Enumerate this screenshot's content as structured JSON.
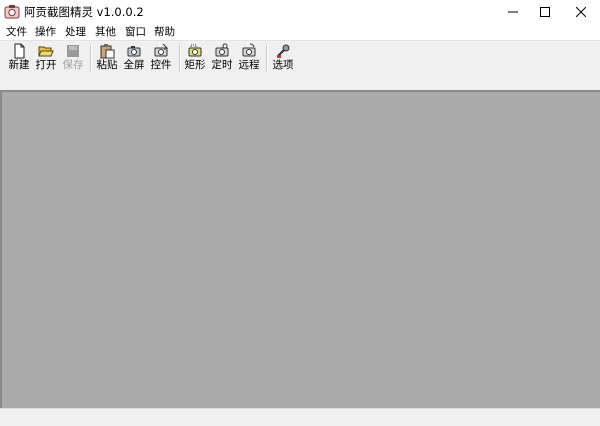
{
  "window": {
    "title": "阿贡截图精灵 v1.0.0.2",
    "icon": "camera-app-icon",
    "controls": [
      "minimize",
      "maximize",
      "close"
    ]
  },
  "menu": [
    "文件",
    "操作",
    "处理",
    "其他",
    "窗口",
    "帮助"
  ],
  "toolbar": {
    "new": {
      "label": "新建",
      "icon": "new-file-icon"
    },
    "open": {
      "label": "打开",
      "icon": "open-folder-icon"
    },
    "save": {
      "label": "保存",
      "icon": "save-icon",
      "disabled": true
    },
    "paste": {
      "label": "粘贴",
      "icon": "paste-icon"
    },
    "fullscreen": {
      "label": "全屏",
      "icon": "fullscreen-capture-icon"
    },
    "control": {
      "label": "控件",
      "icon": "control-capture-icon"
    },
    "rect": {
      "label": "矩形",
      "icon": "rect-capture-icon"
    },
    "timer": {
      "label": "定时",
      "icon": "timer-capture-icon"
    },
    "remote": {
      "label": "远程",
      "icon": "remote-capture-icon"
    },
    "options": {
      "label": "选项",
      "icon": "options-icon"
    }
  },
  "colors": {
    "workspace": "#ababab",
    "toolbar": "#f0f0f0"
  }
}
